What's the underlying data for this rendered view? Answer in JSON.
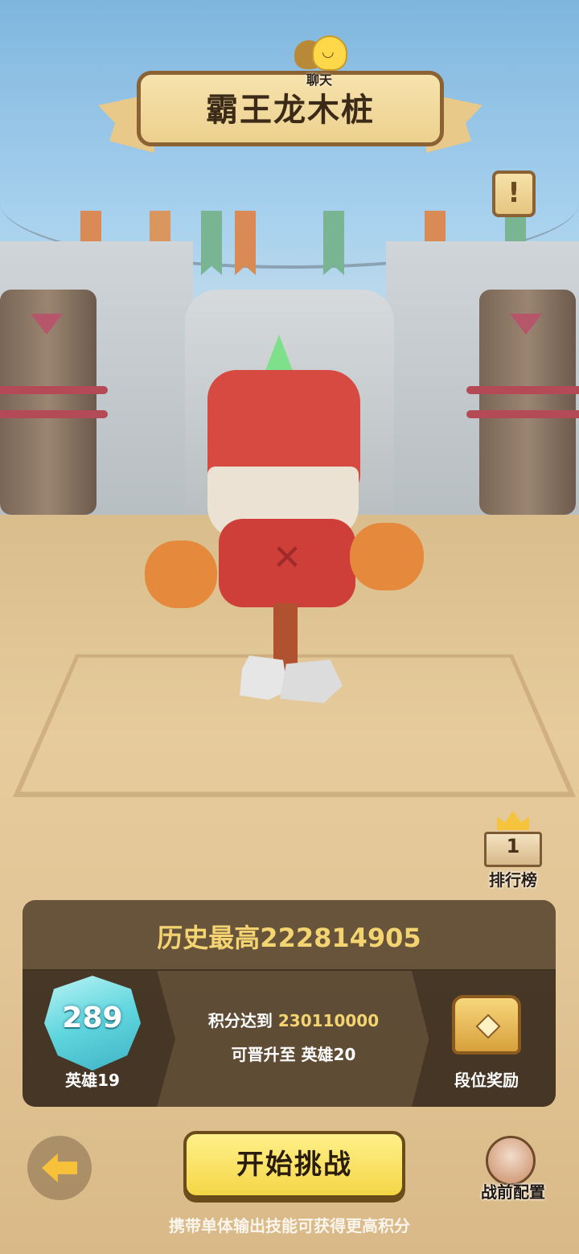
{
  "header": {
    "chat_label": "聊天",
    "stage_title": "霸王龙木桩",
    "info_icon": "exclamation-icon"
  },
  "leaderboard": {
    "label": "排行榜",
    "podium_number": "1"
  },
  "panel": {
    "best_score": "历史最高222814905",
    "rank": {
      "score": "289",
      "tier": "英雄19"
    },
    "requirement": {
      "prefix": "积分达到",
      "target": "230110000",
      "promote_text": "可晋升至 英雄20"
    },
    "reward_label": "段位奖励"
  },
  "footer": {
    "start_label": "开始挑战",
    "preset_label": "战前配置",
    "tip": "携带单体输出技能可获得更高积分"
  },
  "colors": {
    "accent_gold": "#f4d470",
    "button_yellow": "#f4d646",
    "panel_bg": "#54422e",
    "badge_cyan": "#5fd6de"
  }
}
